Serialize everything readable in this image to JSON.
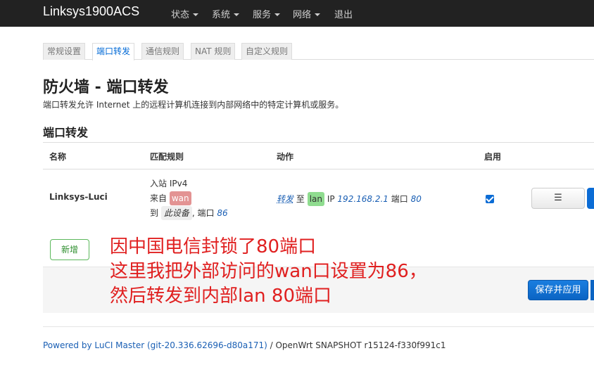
{
  "navbar": {
    "brand": "Linksys1900ACS",
    "menu": [
      "状态",
      "系统",
      "服务",
      "网络"
    ],
    "logout": "退出"
  },
  "tabs": [
    "常规设置",
    "端口转发",
    "通信规则",
    "NAT 规则",
    "自定义规则"
  ],
  "page": {
    "title": "防火墙 - 端口转发",
    "description": "端口转发允许 Internet 上的远程计算机连接到内部网络中的特定计算机或服务。",
    "section_title": "端口转发"
  },
  "table": {
    "headers": [
      "名称",
      "匹配规则",
      "动作",
      "启用"
    ],
    "row": {
      "name": "Linksys-Luci",
      "match_line1": "入站 IPv4",
      "match_from": "来自",
      "match_zone": "wan",
      "match_to": "到",
      "match_device": "此设备",
      "match_port_label": ", 端口",
      "match_port": "86",
      "action_link": "转发",
      "action_to": "至",
      "action_zone": "lan",
      "action_ip_label": "IP",
      "action_ip": "192.168.2.1",
      "action_port_label": "端口",
      "action_port": "80",
      "enabled": true,
      "edit_icon": "☰"
    }
  },
  "buttons": {
    "add": "新增",
    "save_apply": "保存并应用"
  },
  "annotation": "因中国电信封锁了80端口\n这里我把外部访问的wan口设置为86，\n然后转发到内部lan 80端口",
  "footer": {
    "powered_link": "Powered by LuCI Master (git-20.336.62696-d80a171)",
    "powered_rest": " / OpenWrt SNAPSHOT r15124-f330f991c1"
  }
}
